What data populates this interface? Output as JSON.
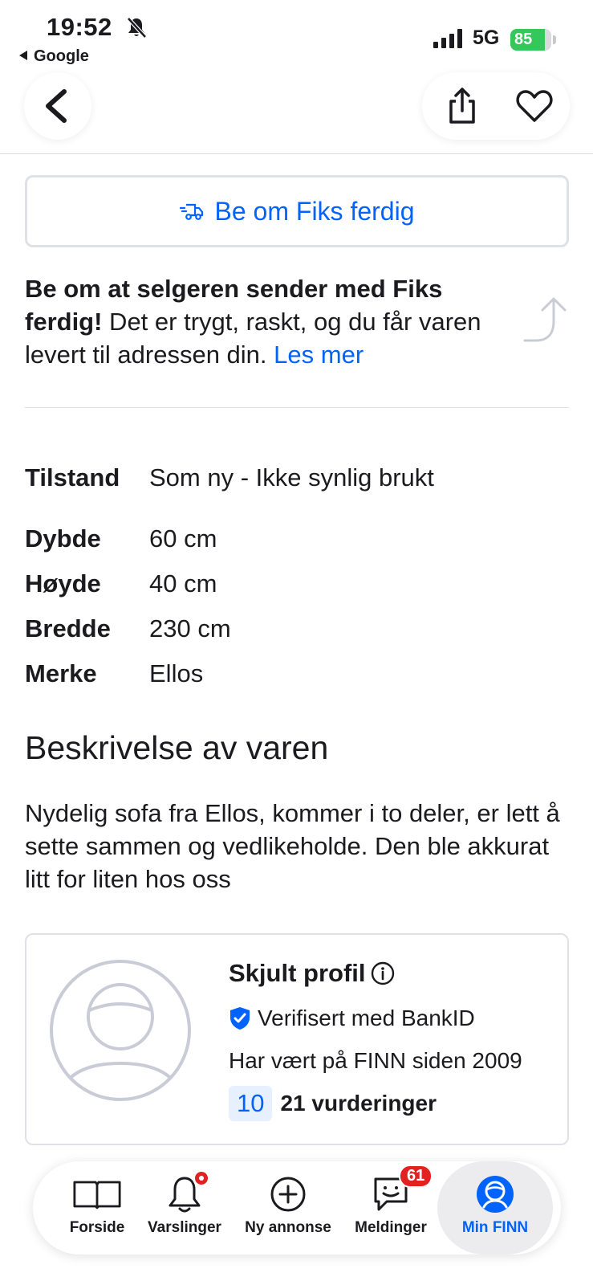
{
  "status_bar": {
    "time": "19:52",
    "back_app": "Google",
    "network": "5G",
    "battery": "85",
    "battery_fraction": 0.85
  },
  "header": {
    "back_icon": "chevron-left-icon",
    "share_icon": "share-icon",
    "favorite_icon": "heart-icon"
  },
  "fiks": {
    "button_label": "Be om Fiks ferdig",
    "button_icon": "delivery-truck-icon",
    "info_bold": "Be om at selgeren sender med Fiks ferdig!",
    "info_text": " Det er trygt, raskt, og du får varen levert til adressen din. ",
    "info_link": "Les mer"
  },
  "specs": [
    {
      "label": "Tilstand",
      "value": "Som ny - Ikke synlig brukt"
    },
    {
      "label": "Dybde",
      "value": "60 cm"
    },
    {
      "label": "Høyde",
      "value": "40 cm"
    },
    {
      "label": "Bredde",
      "value": "230 cm"
    },
    {
      "label": "Merke",
      "value": "Ellos"
    }
  ],
  "description": {
    "title": "Beskrivelse av varen",
    "body": "Nydelig sofa fra Ellos, kommer i to deler, er lett å sette sammen og vedlikeholde. Den ble akkurat litt for liten hos oss"
  },
  "profile": {
    "name": "Skjult profil",
    "verified": "Verifisert med BankID",
    "member_since": "Har vært på FINN siden 2009",
    "score": "10",
    "reviews": "21 vurderinger"
  },
  "tabs": [
    {
      "label": "Forside",
      "icon": "book-icon"
    },
    {
      "label": "Varslinger",
      "icon": "bell-icon"
    },
    {
      "label": "Ny annonse",
      "icon": "plus-circle-icon"
    },
    {
      "label": "Meldinger",
      "icon": "chat-icon",
      "badge": "61"
    },
    {
      "label": "Min FINN",
      "icon": "profile-icon",
      "active": true
    }
  ],
  "colors": {
    "accent": "#0063fb",
    "badge": "#e32121",
    "battery": "#34c759",
    "border": "#dfe1e6"
  }
}
